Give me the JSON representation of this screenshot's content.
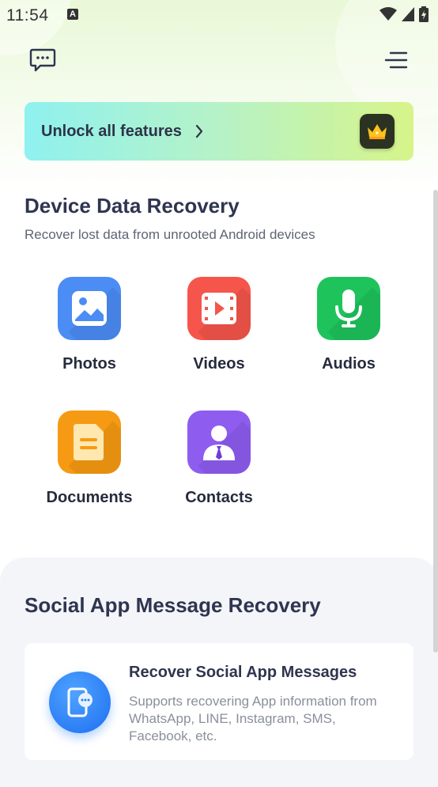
{
  "status_bar": {
    "time": "11:54",
    "notification_letter": "A"
  },
  "header": {
    "feedback_icon": "chat-bubble-icon",
    "menu_icon": "hamburger-menu-icon"
  },
  "promo": {
    "label": "Unlock all features",
    "chevron_icon": "chevron-right-icon",
    "badge_icon": "crown-icon"
  },
  "device_recovery": {
    "title": "Device Data Recovery",
    "subtitle": "Recover lost data from unrooted Android devices",
    "items": [
      {
        "label": "Photos",
        "icon": "photo-icon",
        "color": "#4b8cf5"
      },
      {
        "label": "Videos",
        "icon": "video-icon",
        "color": "#f5554a"
      },
      {
        "label": "Audios",
        "icon": "microphone-icon",
        "color": "#1fc35c"
      },
      {
        "label": "Documents",
        "icon": "document-icon",
        "color": "#f79a13"
      },
      {
        "label": "Contacts",
        "icon": "contact-icon",
        "color": "#8e5df0"
      }
    ]
  },
  "social_recovery": {
    "title": "Social App Message Recovery",
    "card_title": "Recover Social App Messages",
    "card_desc": "Supports recovering App information from WhatsApp, LINE, Instagram, SMS, Facebook, etc.",
    "card_icon": "phone-message-icon"
  }
}
